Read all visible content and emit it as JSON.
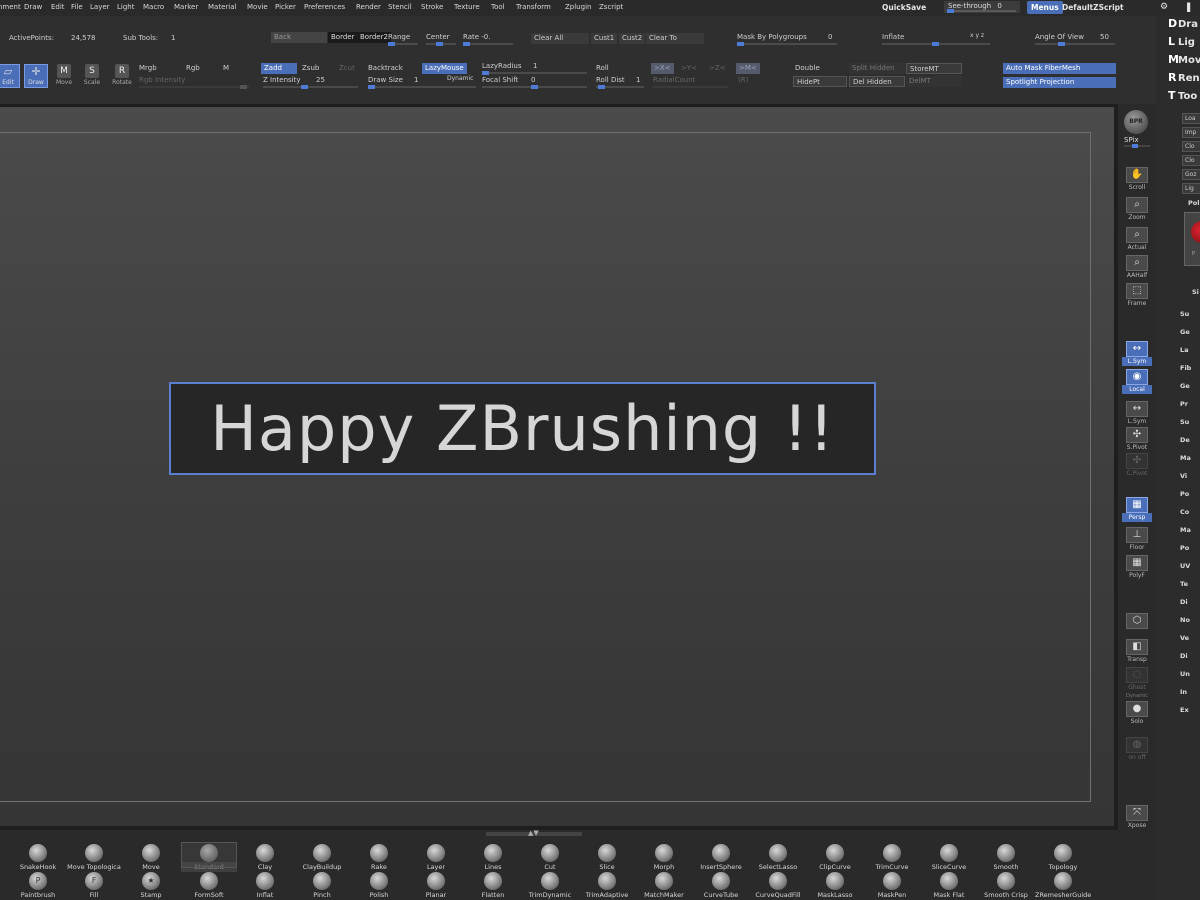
{
  "menubar": {
    "items": [
      "nment",
      "Draw",
      "Edit",
      "File",
      "Layer",
      "Light",
      "Macro",
      "Marker",
      "Material",
      "Movie",
      "Picker",
      "Preferences",
      "Render",
      "Stencil",
      "Stroke",
      "Texture",
      "Tool",
      "Transform",
      "Zplugin",
      "Zscript"
    ],
    "quicksave": "QuickSave",
    "seethrough": "See-through",
    "seethrough_value": "0",
    "seethrough_level": 0,
    "menus": "Menus",
    "default_zscript": "DefaultZScript"
  },
  "toolbar": {
    "active_points_label": "ActivePoints:",
    "active_points": "24,578",
    "sub_tools_label": "Sub Tools:",
    "sub_tools": "1",
    "back": "Back",
    "border": "Border",
    "border2": "Border2",
    "range": "Range",
    "center": "Center",
    "rate": "Rate -0.",
    "clear_all": "Clear All",
    "cust1": "Cust1",
    "cust2": "Cust2",
    "clear_to": "Clear To",
    "mask_by_polygroups": "Mask By Polygroups",
    "mask_by_polygroups_value": "0",
    "inflate": "Inflate",
    "xyz": "x y z",
    "angle_of_view": "Angle Of View",
    "angle_of_view_value": "50",
    "edit": "Edit",
    "draw": "Draw",
    "move": "Move",
    "scale": "Scale",
    "rotate": "Rotate",
    "mrgb": "Mrgb",
    "rgb": "Rgb",
    "m": "M",
    "rgb_intensity": "Rgb Intensity",
    "zadd": "Zadd",
    "zsub": "Zsub",
    "zcut": "Zcut",
    "z_intensity": "Z Intensity",
    "z_intensity_value": "25",
    "backtrack": "Backtrack",
    "lazymouse": "LazyMouse",
    "draw_size": "Draw Size",
    "draw_size_value": "1",
    "dynamic": "Dynamic",
    "lazyradius": "LazyRadius",
    "lazyradius_value": "1",
    "focal_shift": "Focal Shift",
    "focal_shift_value": "0",
    "roll": "Roll",
    "roll_dist": "Roll Dist",
    "roll_dist_value": "1",
    "sym_x": ">X<",
    "sym_y": ">Y<",
    "sym_z": ">Z<",
    "sym_m": ">M<",
    "radialcount": "RadialCount",
    "r": "(R)",
    "double": "Double",
    "split_hidden": "Split Hidden",
    "storemt": "StoreMT",
    "hidept": "HidePt",
    "del_hidden": "Del Hidden",
    "delmt": "DelMT",
    "auto_mask_fibermesh": "Auto Mask FiberMesh",
    "spotlight_projection": "Spotlight Projection"
  },
  "canvas": {
    "text": "Happy ZBrushing !!"
  },
  "shelf": {
    "bpr": "BPR",
    "spix": "SPix",
    "scroll": "Scroll",
    "zoom": "Zoom",
    "actual": "Actual",
    "aahalf": "AAHalf",
    "frame": "Frame",
    "lsym": "L.Sym",
    "local": "Local",
    "lsym2": "L.Sym",
    "spivot": "S.Pivot",
    "cpivot": "C.Pivot",
    "persp": "Persp",
    "floor": "Floor",
    "polyf": "PolyF",
    "transp": "Transp",
    "ghost": "Ghost",
    "dynamic": "Dynamic",
    "solo": "Solo",
    "on": "on",
    "off": "off",
    "xpose": "Xpose"
  },
  "rightpanel": {
    "top_items": [
      {
        "icon": "D",
        "label": "Dra"
      },
      {
        "icon": "L",
        "label": "Lig"
      },
      {
        "icon": "M",
        "label": "Mov"
      },
      {
        "icon": "R",
        "label": "Ren"
      },
      {
        "icon": "T",
        "label": "Too"
      }
    ],
    "boxes": [
      "Loa",
      "Imp",
      "Clo",
      "Clo",
      "Goz",
      "Lig"
    ],
    "pol": "Pol",
    "thumb_letter": "P",
    "si": "Si",
    "side_items": [
      "Su",
      "Ge",
      "La",
      "Fib",
      "Ge",
      "Pr",
      "Su",
      "De",
      "Ma",
      "Vi",
      "Po",
      "Co",
      "Ma",
      "Po",
      "UV",
      "Te",
      "Di",
      "No",
      "Ve",
      "Di",
      "Un",
      "In",
      "Ex"
    ]
  },
  "brushes": {
    "row1": [
      "SnakeHook",
      "Move Topologica",
      "Move",
      "Standard",
      "Clay",
      "ClayBuildup",
      "Rake",
      "Layer",
      "Lines",
      "Cut",
      "Slice",
      "Morph",
      "InsertSphere",
      "SelectLasso",
      "ClipCurve",
      "TrimCurve",
      "SliceCurve",
      "Smooth",
      "Topology"
    ],
    "row2": [
      "Paintbrush",
      "Fill",
      "Stamp",
      "FormSoft",
      "Inflat",
      "Pinch",
      "Polish",
      "Planar",
      "Flatten",
      "TrimDynamic",
      "TrimAdaptive",
      "MatchMaker",
      "CurveTube",
      "CurveQuadFill",
      "MaskLasso",
      "MaskPen",
      "Mask Flat",
      "Smooth Crisp",
      "ZRemesherGuide"
    ],
    "selected": "Standard"
  },
  "colors": {
    "accent": "#4a6fb8",
    "highlight_border": "#5b7fd0",
    "canvas_text": "#d6d6d6"
  }
}
